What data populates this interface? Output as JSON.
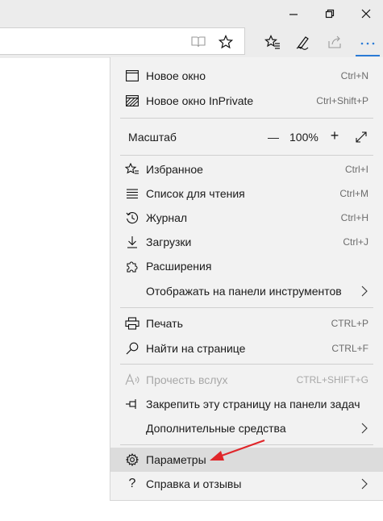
{
  "window": {
    "buttons": [
      "minimize",
      "restore",
      "close"
    ]
  },
  "toolbar": {
    "icons": [
      "reading-view-icon",
      "favorite-star-icon",
      "favorites-hub-icon",
      "web-note-icon",
      "share-icon",
      "more-icon"
    ]
  },
  "menu": {
    "new_window": {
      "label": "Новое окно",
      "shortcut": "Ctrl+N"
    },
    "new_private": {
      "label": "Новое окно InPrivate",
      "shortcut": "Ctrl+Shift+P"
    },
    "zoom": {
      "label": "Масштаб",
      "minus": "—",
      "value": "100%",
      "plus": "+"
    },
    "favorites": {
      "label": "Избранное",
      "shortcut": "Ctrl+I"
    },
    "reading_list": {
      "label": "Список для чтения",
      "shortcut": "Ctrl+M"
    },
    "history": {
      "label": "Журнал",
      "shortcut": "Ctrl+H"
    },
    "downloads": {
      "label": "Загрузки",
      "shortcut": "Ctrl+J"
    },
    "extensions": {
      "label": "Расширения"
    },
    "show_in_toolbar": {
      "label": "Отображать на панели инструментов"
    },
    "print": {
      "label": "Печать",
      "shortcut": "CTRL+P"
    },
    "find": {
      "label": "Найти на странице",
      "shortcut": "CTRL+F"
    },
    "read_aloud": {
      "label": "Прочесть вслух",
      "shortcut": "CTRL+SHIFT+G"
    },
    "pin_taskbar": {
      "label": "Закрепить эту страницу на панели задач"
    },
    "more_tools": {
      "label": "Дополнительные средства"
    },
    "settings": {
      "label": "Параметры"
    },
    "help": {
      "label": "Справка и отзывы"
    }
  },
  "colors": {
    "accent": "#2b7bd6",
    "annotation_arrow": "#e0262a",
    "hover": "#dcdcdc"
  }
}
